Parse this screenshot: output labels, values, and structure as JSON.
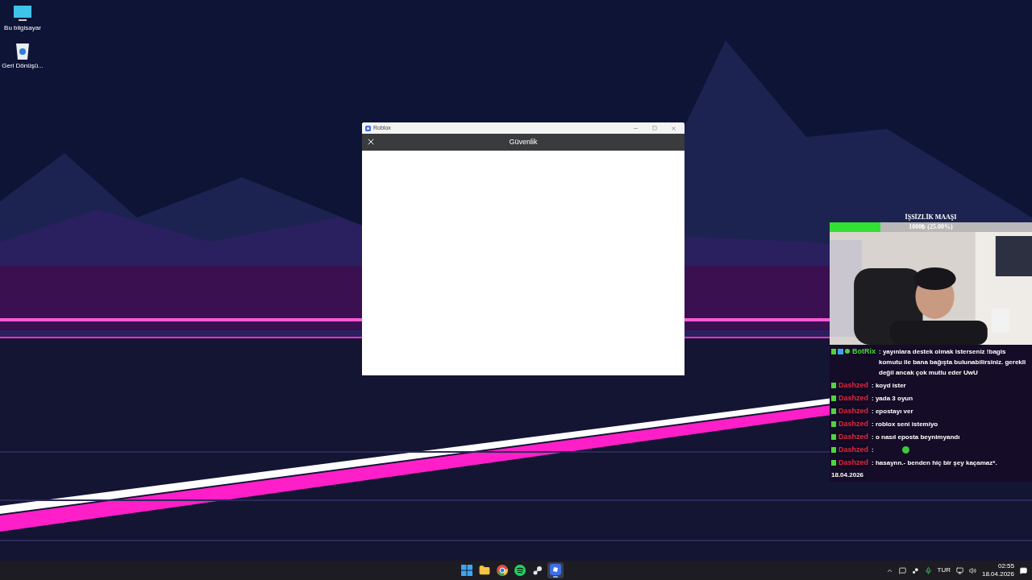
{
  "desktop_icons": [
    {
      "kind": "computer",
      "label": "Bu bilgisayar"
    },
    {
      "kind": "recycle",
      "label": "Geri Dönüşü..."
    }
  ],
  "window": {
    "app": "Roblox",
    "title": "Güvenlik"
  },
  "goal": {
    "title": "İŞSİZLİK MAAŞI",
    "reading": "1000₺ (25.00%)",
    "level": 0.25
  },
  "chat": [
    {
      "user": "BotRix",
      "color": "#4fd63a",
      "badges": [
        {
          "kind": "k"
        },
        {
          "kind": "bot"
        },
        {
          "kind": "verified"
        }
      ],
      "text": ": yayınlara destek olmak isterseniz !bagis komutu ile bana bağışta bulunabilirsiniz. gerekli değil ancak çok mutlu eder UwU"
    },
    {
      "user": "Dashzed",
      "color": "#e0283c",
      "badges": [
        {
          "kind": "k"
        }
      ],
      "text": ": koyd ister"
    },
    {
      "user": "Dashzed",
      "color": "#e0283c",
      "badges": [
        {
          "kind": "k"
        }
      ],
      "text": ": yada 3 oyun"
    },
    {
      "user": "Dashzed",
      "color": "#e0283c",
      "badges": [
        {
          "kind": "k"
        }
      ],
      "text": ": epostayı ver"
    },
    {
      "user": "Dashzed",
      "color": "#e0283c",
      "badges": [
        {
          "kind": "k"
        }
      ],
      "text": ": roblox seni istemiyo"
    },
    {
      "user": "Dashzed",
      "color": "#e0283c",
      "badges": [
        {
          "kind": "k"
        }
      ],
      "text": ": o nasıl eposta beynimyandı"
    },
    {
      "user": "Dashzed",
      "color": "#e0283c",
      "badges": [
        {
          "kind": "k"
        }
      ],
      "text": ":",
      "emote": true
    },
    {
      "user": "Dashzed",
      "color": "#e0283c",
      "badges": [
        {
          "kind": "k"
        }
      ],
      "text": ": hasaynn.- benden hiç bir şey kaçamaz*."
    }
  ],
  "chat_date": "18.04.2026",
  "taskbar": [
    {
      "kind": "start",
      "selected": false
    },
    {
      "kind": "folder",
      "selected": false
    },
    {
      "kind": "browser",
      "selected": false
    },
    {
      "kind": "music",
      "selected": false
    },
    {
      "kind": "steam",
      "selected": false
    },
    {
      "kind": "roblox",
      "selected": true
    }
  ],
  "tray": {
    "language": "TUR",
    "time": "02:55",
    "date": "18.04.2026"
  }
}
